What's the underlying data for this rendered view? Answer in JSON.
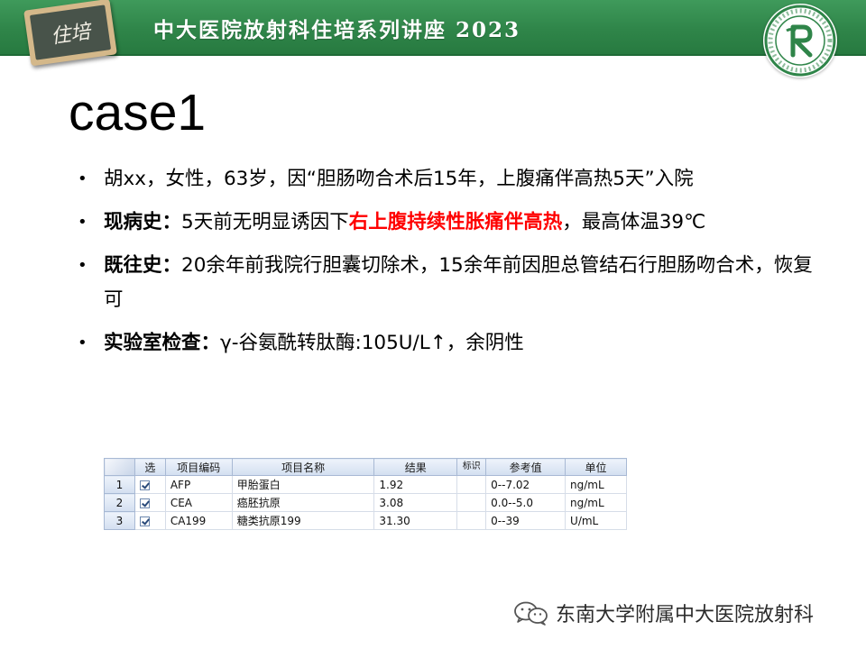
{
  "header": {
    "badge_text": "住培",
    "title": "中大医院放射科住培系列讲座 2023",
    "emblem_icon": "hospital-radiology-logo"
  },
  "slide": {
    "title": "case1",
    "bullets": [
      {
        "lead": "",
        "text": "胡xx，女性，63岁，因“胆肠吻合术后15年，上腹痛伴高热5天”入院"
      },
      {
        "lead": "现病史：",
        "text": "5天前无明显诱因下",
        "highlight": "右上腹持续性胀痛伴高热",
        "tail": "，最高体温39℃"
      },
      {
        "lead": "既往史：",
        "text": "20余年前我院行胆囊切除术，15余年前因胆总管结石行胆肠吻合术，恢复可"
      },
      {
        "lead": "实验室检查：",
        "text": "γ-谷氨酰转肽酶:105U/L↑，余阴性"
      }
    ]
  },
  "lab_table": {
    "headers": [
      "选",
      "项目编码",
      "项目名称",
      "结果",
      "标识",
      "参考值",
      "单位"
    ],
    "rows": [
      {
        "num": "1",
        "checked": true,
        "code": "AFP",
        "name": "甲胎蛋白",
        "result": "1.92",
        "flag": "",
        "ref": "0--7.02",
        "unit": "ng/mL"
      },
      {
        "num": "2",
        "checked": true,
        "code": "CEA",
        "name": "癌胚抗原",
        "result": "3.08",
        "flag": "",
        "ref": "0.0--5.0",
        "unit": "ng/mL"
      },
      {
        "num": "3",
        "checked": true,
        "code": "CA199",
        "name": "糖类抗原199",
        "result": "31.30",
        "flag": "",
        "ref": "0--39",
        "unit": "U/mL"
      }
    ]
  },
  "footer": {
    "icon": "wechat-icon",
    "text": "东南大学附属中大医院放射科"
  },
  "colors": {
    "banner": "#2f8549",
    "highlight": "#ff0000"
  }
}
